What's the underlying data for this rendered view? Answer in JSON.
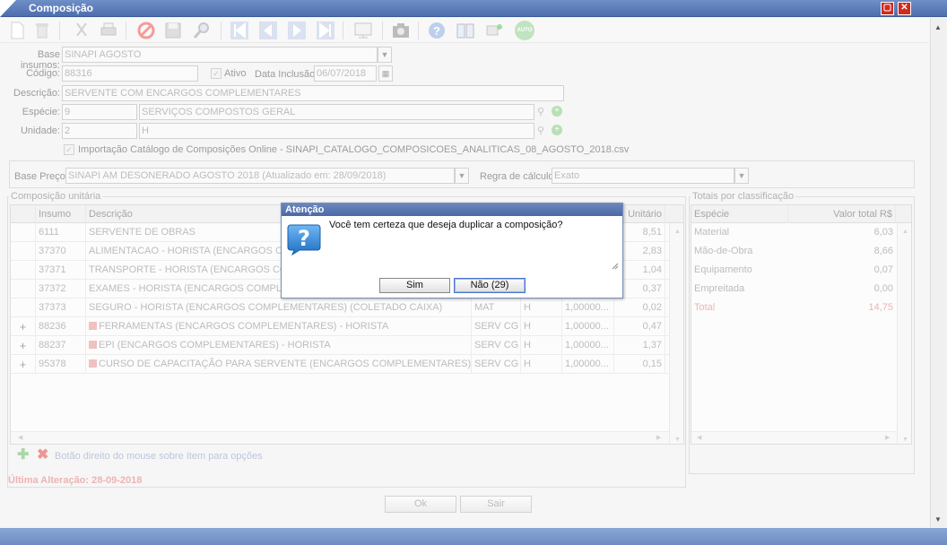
{
  "window": {
    "title": "Composição"
  },
  "toolbar": {
    "icons": [
      "new-icon",
      "delete-icon",
      "cut-icon",
      "print-icon",
      "cancel-icon",
      "save-icon",
      "search-icon",
      "first-icon",
      "prev-icon",
      "next-icon",
      "last-icon",
      "report-icon",
      "camera-icon",
      "help-icon",
      "book-icon",
      "plugin-icon",
      "auto-icon"
    ],
    "auto_label": "AUTO"
  },
  "form": {
    "base_insumos_label": "Base insumos:",
    "base_insumos_value": "SINAPI AGOSTO",
    "codigo_label": "Código:",
    "codigo_value": "88316",
    "ativo_label": "Ativo",
    "data_inclusao_label": "Data Inclusão:",
    "data_inclusao_value": "06/07/2018",
    "descricao_label": "Descrição:",
    "descricao_value": "SERVENTE COM ENCARGOS COMPLEMENTARES",
    "especie_label": "Espécie:",
    "especie_code": "9",
    "especie_name": "SERVIÇOS COMPOSTOS GERAL",
    "unidade_label": "Unidade:",
    "unidade_code": "2",
    "unidade_name": "H",
    "importacao_label": "Importação Catálogo de Composições Online - SINAPI_CATALOGO_COMPOSICOES_ANALITICAS_08_AGOSTO_2018.csv",
    "base_preco_label": "Base Preço:",
    "base_preco_value": "SINAPI AM DESONERADO AGOSTO 2018 (Atualizado em: 28/09/2018)",
    "regra_label": "Regra de cálculo:",
    "regra_value": "Exato"
  },
  "composicao": {
    "legend": "Composição unitária",
    "headers": {
      "insumo": "Insumo",
      "descricao": "Descrição",
      "unitario": "Unitário"
    },
    "rows": [
      {
        "expand": "",
        "insumo": "6111",
        "icon": false,
        "descricao": "SERVENTE DE OBRAS",
        "classe": "",
        "un": "",
        "coef": "",
        "unitario": "8,51"
      },
      {
        "expand": "",
        "insumo": "37370",
        "icon": false,
        "descricao": "ALIMENTACAO - HORISTA (ENCARGOS COM",
        "classe": "",
        "un": "",
        "coef": "",
        "unitario": "2,83"
      },
      {
        "expand": "",
        "insumo": "37371",
        "icon": false,
        "descricao": "TRANSPORTE - HORISTA (ENCARGOS COM",
        "classe": "",
        "un": "",
        "coef": "",
        "unitario": "1,04"
      },
      {
        "expand": "",
        "insumo": "37372",
        "icon": false,
        "descricao": "EXAMES - HORISTA (ENCARGOS COMPLEME",
        "classe": "",
        "un": "",
        "coef": "",
        "unitario": "0,37"
      },
      {
        "expand": "",
        "insumo": "37373",
        "icon": false,
        "descricao": "SEGURO - HORISTA (ENCARGOS COMPLEMENTARES) (COLETADO CAIXA)",
        "classe": "MAT",
        "un": "H",
        "coef": "1,00000...",
        "unitario": "0,02"
      },
      {
        "expand": "+",
        "insumo": "88236",
        "icon": true,
        "descricao": "FERRAMENTAS (ENCARGOS COMPLEMENTARES) - HORISTA",
        "classe": "SERV CG",
        "un": "H",
        "coef": "1,00000...",
        "unitario": "0,47"
      },
      {
        "expand": "+",
        "insumo": "88237",
        "icon": true,
        "descricao": "EPI (ENCARGOS COMPLEMENTARES) - HORISTA",
        "classe": "SERV CG",
        "un": "H",
        "coef": "1,00000...",
        "unitario": "1,37"
      },
      {
        "expand": "+",
        "insumo": "95378",
        "icon": true,
        "descricao": "CURSO DE CAPACITAÇÃO PARA SERVENTE (ENCARGOS COMPLEMENTARES) - H...",
        "classe": "SERV CG",
        "un": "H",
        "coef": "1,00000...",
        "unitario": "0,15"
      }
    ],
    "hint": "Botão direito do mouse sobre ítem para opções",
    "last_change": "Última Alteração: 28-09-2018"
  },
  "totais": {
    "legend": "Totais por classificação",
    "headers": {
      "especie": "Espécie",
      "valor": "Valor total R$"
    },
    "rows": [
      {
        "especie": "Material",
        "valor": "6,03"
      },
      {
        "especie": "Mão-de-Obra",
        "valor": "8,66"
      },
      {
        "especie": "Equipamento",
        "valor": "0,07"
      },
      {
        "especie": "Empreitada",
        "valor": "0,00"
      },
      {
        "especie": "Total",
        "valor": "14,75"
      }
    ]
  },
  "footer": {
    "ok_label": "Ok",
    "sair_label": "Sair"
  },
  "dialog": {
    "title": "Atenção",
    "message": "Você tem certeza que deseja duplicar a composição?",
    "yes_label": "Sim",
    "no_label": "Não (29)"
  },
  "colors": {
    "accent": "#4d6eae",
    "total": "#e58a8a",
    "close": "#d12a1f"
  }
}
